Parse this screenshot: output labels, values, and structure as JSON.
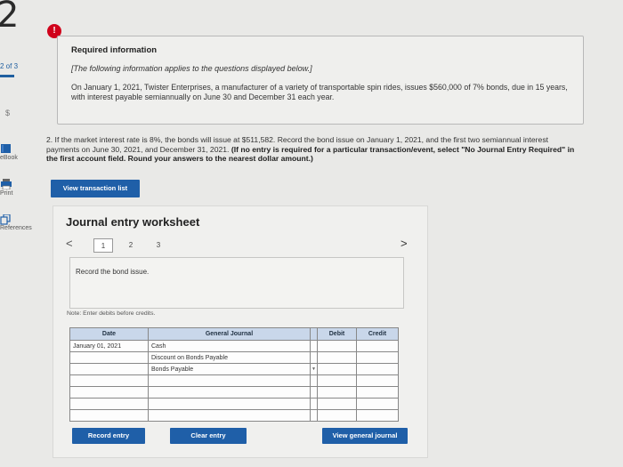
{
  "question_number": "2",
  "sidebar": {
    "progress": "2 of 3",
    "currency_symbol": "$",
    "items": [
      {
        "label": "eBook",
        "icon": "book-icon"
      },
      {
        "label": "Print",
        "icon": "printer-icon"
      },
      {
        "label": "References",
        "icon": "copy-icon"
      }
    ]
  },
  "alert_icon": "!",
  "info": {
    "title": "Required information",
    "subtitle": "[The following information applies to the questions displayed below.]",
    "body": "On January 1, 2021, Twister Enterprises, a manufacturer of a variety of transportable spin rides, issues $560,000 of 7% bonds, due in 15 years, with interest payable semiannually on June 30 and December 31 each year."
  },
  "question": {
    "text": "2. If the market interest rate is 8%, the bonds will issue at $511,582. Record the bond issue on January 1, 2021, and the first two semiannual interest payments on June 30, 2021, and December 31, 2021.",
    "instruction": "(If no entry is required for a particular transaction/event, select \"No Journal Entry Required\" in the first account field. Round your answers to the nearest dollar amount.)"
  },
  "view_transaction_button": "View transaction list",
  "worksheet": {
    "title": "Journal entry worksheet",
    "prev": "<",
    "next": ">",
    "pages": [
      "1",
      "2",
      "3"
    ],
    "current_page": "1",
    "task": "Record the bond issue.",
    "note": "Note: Enter debits before credits.",
    "columns": {
      "date": "Date",
      "general_journal": "General Journal",
      "debit": "Debit",
      "credit": "Credit"
    },
    "rows": [
      {
        "date": "January 01, 2021",
        "account": "Cash",
        "debit": "",
        "credit": ""
      },
      {
        "date": "",
        "account": "Discount on Bonds Payable",
        "debit": "",
        "credit": ""
      },
      {
        "date": "",
        "account": "Bonds Payable",
        "debit": "",
        "credit": ""
      },
      {
        "date": "",
        "account": "",
        "debit": "",
        "credit": ""
      },
      {
        "date": "",
        "account": "",
        "debit": "",
        "credit": ""
      },
      {
        "date": "",
        "account": "",
        "debit": "",
        "credit": ""
      },
      {
        "date": "",
        "account": "",
        "debit": "",
        "credit": ""
      }
    ],
    "buttons": {
      "record": "Record entry",
      "clear": "Clear entry",
      "view_general": "View general journal"
    }
  },
  "colors": {
    "accent": "#1f5fa8",
    "alert": "#d0021b",
    "table_header": "#c9d7ea"
  }
}
